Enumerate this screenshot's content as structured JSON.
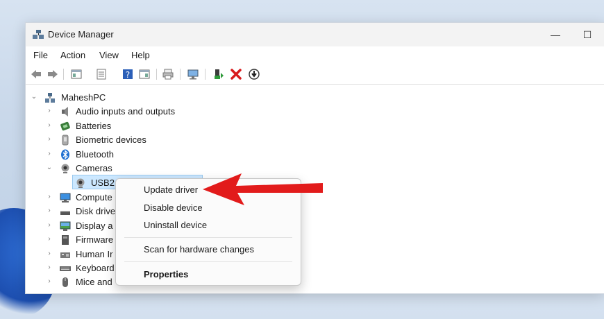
{
  "window": {
    "title": "Device Manager",
    "minimize_glyph": "—",
    "maximize_glyph": "☐"
  },
  "menubar": {
    "items": [
      "File",
      "Action",
      "View",
      "Help"
    ]
  },
  "toolbar": {
    "buttons": [
      "back-icon",
      "forward-icon",
      "show-hide-console-tree-icon",
      "properties-icon",
      "help-icon",
      "action-pane-icon",
      "print-icon",
      "scan-hardware-icon",
      "update-driver-icon",
      "uninstall-icon",
      "disable-icon"
    ]
  },
  "tree": {
    "root": "MaheshPC",
    "items": [
      {
        "label": "Audio inputs and outputs",
        "icon": "speaker-icon",
        "expanded": false
      },
      {
        "label": "Batteries",
        "icon": "battery-icon",
        "expanded": false
      },
      {
        "label": "Biometric devices",
        "icon": "biometric-icon",
        "expanded": false
      },
      {
        "label": "Bluetooth",
        "icon": "bluetooth-icon",
        "expanded": false
      },
      {
        "label": "Cameras",
        "icon": "camera-icon",
        "expanded": true
      },
      {
        "label": "USB2.",
        "icon": "webcam-icon",
        "child": true,
        "selected": true
      },
      {
        "label": "Compute",
        "icon": "computer-icon",
        "expanded": false
      },
      {
        "label": "Disk drive",
        "icon": "disk-icon",
        "expanded": false
      },
      {
        "label": "Display a",
        "icon": "display-icon",
        "expanded": false
      },
      {
        "label": "Firmware",
        "icon": "firmware-icon",
        "expanded": false
      },
      {
        "label": "Human Ir",
        "icon": "hid-icon",
        "expanded": false
      },
      {
        "label": "Keyboard",
        "icon": "keyboard-icon",
        "expanded": false
      },
      {
        "label": "Mice and",
        "icon": "mouse-icon",
        "expanded": false
      }
    ]
  },
  "context_menu": {
    "items": [
      "Update driver",
      "Disable device",
      "Uninstall device",
      "Scan for hardware changes",
      "Properties"
    ]
  },
  "colors": {
    "arrow": "#e21b1b",
    "selection": "#cce8ff",
    "accent": "#0067c0"
  }
}
